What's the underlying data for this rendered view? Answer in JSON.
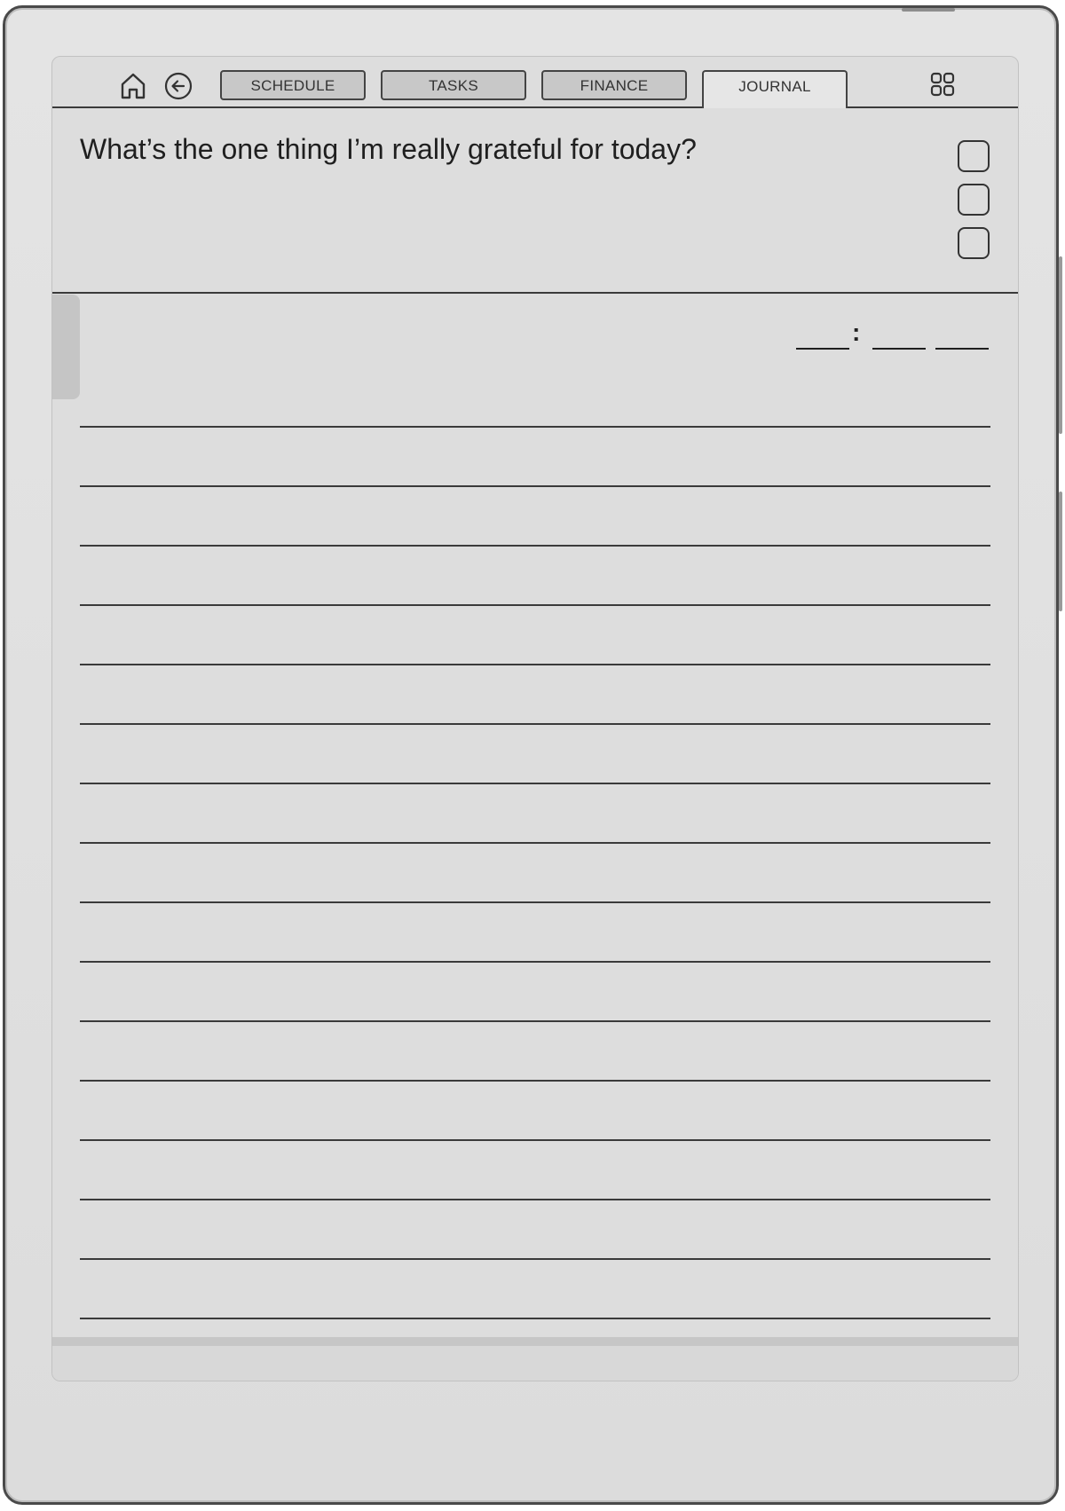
{
  "toolbar": {
    "home_icon": "home-icon",
    "back_icon": "back-arrow-circle-icon",
    "apps_icon": "grid-apps-icon",
    "tabs": [
      {
        "label": "SCHEDULE",
        "active": false
      },
      {
        "label": "TASKS",
        "active": false
      },
      {
        "label": "FINANCE",
        "active": false
      },
      {
        "label": "JOURNAL",
        "active": true
      }
    ]
  },
  "journal": {
    "prompt": "What’s the one thing I’m really grateful for today?",
    "time_separator": ":",
    "checkbox_count": 3,
    "ruled_line_count": 16
  },
  "colors": {
    "screen": "#dddddd",
    "ink": "#1f1f1f",
    "bezel": "#e0e0e0",
    "frame": "#4a4a4a"
  }
}
